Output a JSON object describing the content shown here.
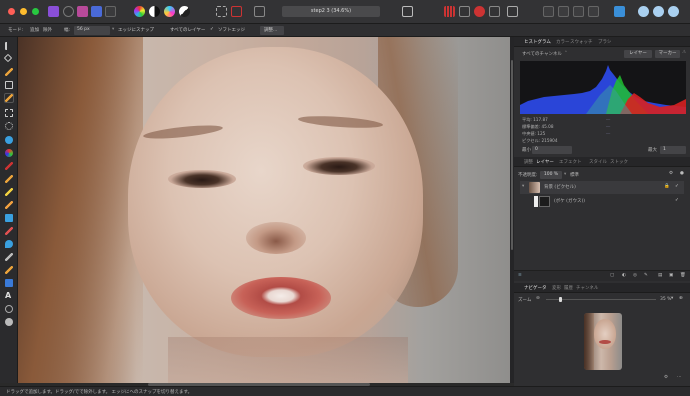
{
  "toolbar": {
    "doc_title": "step2 3 (34.6%)"
  },
  "context_bar": {
    "mode_label": "モード:",
    "mode_add": "追加",
    "mode_subtract": "除外",
    "width_label": "幅:",
    "width_value": "56 px",
    "snap_edges": "エッジにスナップ",
    "all_layers": "すべてのレイヤー",
    "soft_edges": "ソフトエッジ",
    "refine_button": "調整..."
  },
  "status": {
    "text": "ドラッグで追加します。ドラッグ/でで除外します。 エッジにへのスナップを切り替えます。"
  },
  "histogram_panel": {
    "tabs": [
      "ヒストグラム",
      "カラー",
      "スウォッチ",
      "ブラシ"
    ],
    "active_tab": "ヒストグラム",
    "channel_select": "すべてのチャンネル",
    "layer_button": "レイヤー",
    "marker_button": "マーカー",
    "stats": {
      "mean": "平均: 117.87",
      "stddev": "標準偏差: 45.08",
      "median": "中央値: 125",
      "pixels": "ピクセル: 215904"
    },
    "min_label": "最小",
    "min_value": "0",
    "max_label": "最大",
    "max_value": "1"
  },
  "layers_panel": {
    "tabs": [
      "調整",
      "レイヤー",
      "エフェクト",
      "スタイル",
      "ストック"
    ],
    "active_tab": "レイヤー",
    "opacity_label": "不透明度:",
    "opacity_value": "100 %",
    "blend_mode": "標準",
    "layers": [
      {
        "name": "背景 (ピクセル)"
      },
      {
        "name": "(ボケ (ガウス))"
      }
    ]
  },
  "navigator_panel": {
    "tabs": [
      "ナビゲータ",
      "変形",
      "履歴",
      "チャンネル"
    ],
    "active_tab": "ナビゲータ",
    "zoom_label": "ズーム",
    "zoom_value": "35 %"
  },
  "colors": {
    "histogram_blue": "#2a45d8",
    "histogram_green": "#20c030",
    "histogram_red": "#d82020",
    "accent": "#3a8fd8"
  }
}
